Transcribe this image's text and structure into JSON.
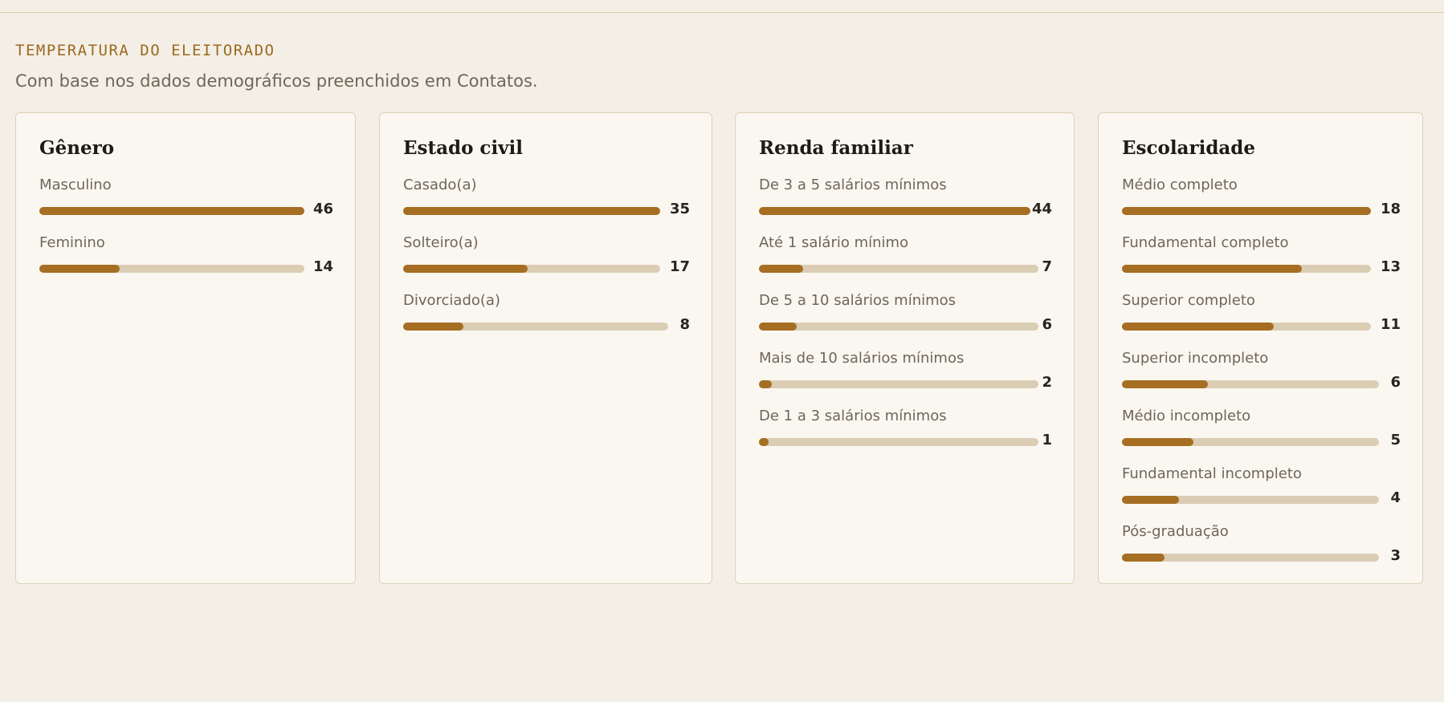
{
  "section": {
    "title": "TEMPERATURA DO ELEITORADO",
    "subtitle": "Com base nos dados demográficos preenchidos em Contatos."
  },
  "cards": [
    {
      "title": "Gênero",
      "max": 46,
      "rows": [
        {
          "label": "Masculino",
          "value": 46
        },
        {
          "label": "Feminino",
          "value": 14
        }
      ]
    },
    {
      "title": "Estado civil",
      "max": 35,
      "rows": [
        {
          "label": "Casado(a)",
          "value": 35
        },
        {
          "label": "Solteiro(a)",
          "value": 17
        },
        {
          "label": "Divorciado(a)",
          "value": 8
        }
      ]
    },
    {
      "title": "Renda familiar",
      "max": 44,
      "rows": [
        {
          "label": "De 3 a 5 salários mínimos",
          "value": 44
        },
        {
          "label": "Até 1 salário mínimo",
          "value": 7
        },
        {
          "label": "De 5 a 10 salários mínimos",
          "value": 6
        },
        {
          "label": "Mais de 10 salários mínimos",
          "value": 2
        },
        {
          "label": "De 1 a 3 salários mínimos",
          "value": 1
        }
      ]
    },
    {
      "title": "Escolaridade",
      "max": 18,
      "rows": [
        {
          "label": "Médio completo",
          "value": 18
        },
        {
          "label": "Fundamental completo",
          "value": 13
        },
        {
          "label": "Superior completo",
          "value": 11
        },
        {
          "label": "Superior incompleto",
          "value": 6
        },
        {
          "label": "Médio incompleto",
          "value": 5
        },
        {
          "label": "Fundamental incompleto",
          "value": 4
        },
        {
          "label": "Pós-graduação",
          "value": 3
        }
      ]
    }
  ],
  "colors": {
    "accent": "#a66e22",
    "track": "#dbcdb4",
    "title_accent": "#9a6a22"
  }
}
